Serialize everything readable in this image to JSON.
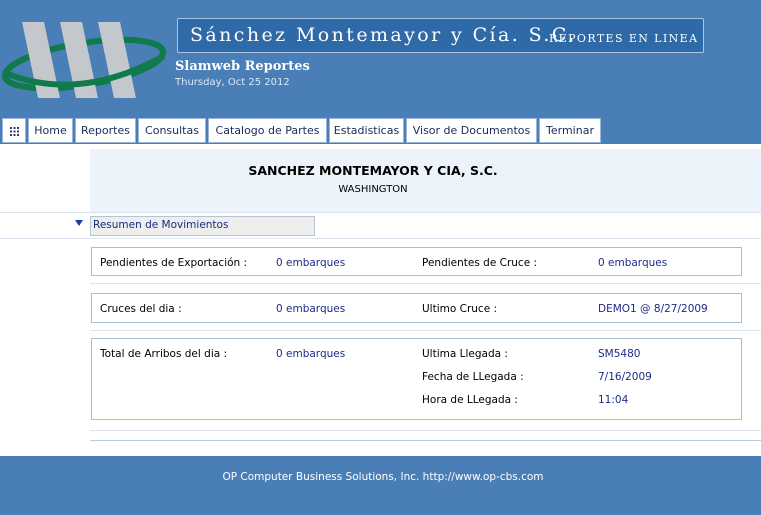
{
  "header": {
    "company_banner": "Sánchez Montemayor y Cía. S.C.",
    "banner_tagline": "REPORTES EN LINEA",
    "app_name": "Slamweb Reportes",
    "date": "Thursday, Oct 25 2012",
    "brand_color": "#4a7eb7"
  },
  "menu": {
    "grid_icon": "grid-icon",
    "items": [
      "Home",
      "Reportes",
      "Consultas",
      "Catalogo de Partes",
      "Estadisticas",
      "Visor de Documentos",
      "Terminar"
    ]
  },
  "company": {
    "name": "SANCHEZ MONTEMAYOR Y CIA, S.C.",
    "city": "WASHINGTON"
  },
  "section": {
    "title": "Resumen de Movimientos",
    "arrow_icon": "triangle-down-icon"
  },
  "summary": {
    "pendientes_exportacion_label": "Pendientes de Exportación :",
    "pendientes_exportacion_value": "0 embarques",
    "pendientes_cruce_label": "Pendientes de Cruce :",
    "pendientes_cruce_value": "0 embarques",
    "cruces_dia_label": "Cruces del dia :",
    "cruces_dia_value": "0 embarques",
    "ultimo_cruce_label": "Ultimo Cruce :",
    "ultimo_cruce_value": "DEMO1 @ 8/27/2009",
    "arribos_dia_label": "Total de Arribos del dia :",
    "arribos_dia_value": "0 embarques",
    "ultima_llegada_label": "Ultima Llegada :",
    "ultima_llegada_value": "SM5480",
    "fecha_llegada_label": "Fecha de LLegada :",
    "fecha_llegada_value": "7/16/2009",
    "hora_llegada_label": "Hora de LLegada :",
    "hora_llegada_value": "11:04"
  },
  "footer": {
    "text": "OP Computer Business Solutions, Inc. http://www.op-cbs.com"
  }
}
